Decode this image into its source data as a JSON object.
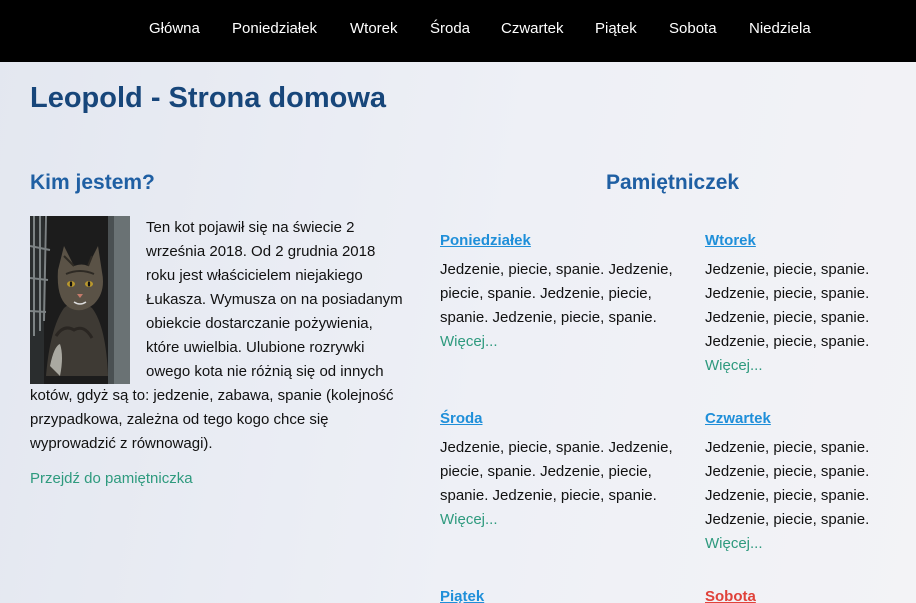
{
  "nav": {
    "items": [
      "Główna",
      "Poniedziałek",
      "Wtorek",
      "Środa",
      "Czwartek",
      "Piątek",
      "Sobota",
      "Niedziela"
    ]
  },
  "page": {
    "title": "Leopold - Strona domowa"
  },
  "about": {
    "heading": "Kim jestem?",
    "text": "Ten kot pojawił się na świecie 2 września 2018. Od 2 grudnia 2018 roku jest właścicielem niejakiego Łukasza. Wymusza on na posiadanym obiekcie dostarczanie pożywienia, które uwielbia. Ulubione rozrywki owego kota nie różnią się od innych kotów, gdyż są to: jedzenie, zabawa, spanie (kolejność przypadkowa, zależna od tego kogo chce się wyprowadzić z równowagi).",
    "link": "Przejdź do pamiętniczka"
  },
  "diary": {
    "heading": "Pamiętniczek",
    "more_label": "Więcej...",
    "entries": [
      {
        "day": "Poniedziałek",
        "text": "Jedzenie, piecie, spanie. Jedzenie, piecie, spanie. Jedzenie, piecie, spanie. Jedzenie, piecie, spanie."
      },
      {
        "day": "Wtorek",
        "text": "Jedzenie, piecie, spanie. Jedzenie, piecie, spanie. Jedzenie, piecie, spanie. Jedzenie, piecie, spanie."
      },
      {
        "day": "Środa",
        "text": "Jedzenie, piecie, spanie. Jedzenie, piecie, spanie. Jedzenie, piecie, spanie. Jedzenie, piecie, spanie."
      },
      {
        "day": "Czwartek",
        "text": "Jedzenie, piecie, spanie. Jedzenie, piecie, spanie. Jedzenie, piecie, spanie. Jedzenie, piecie, spanie."
      },
      {
        "day": "Piątek",
        "text": ""
      },
      {
        "day": "Sobota",
        "text": ""
      }
    ]
  },
  "colors": {
    "nav_bg": "#000000",
    "title": "#17467a",
    "heading": "#1f5fa3",
    "day_link": "#1f8fd9",
    "saturday": "#e0423a",
    "link": "#2e9a7e"
  }
}
